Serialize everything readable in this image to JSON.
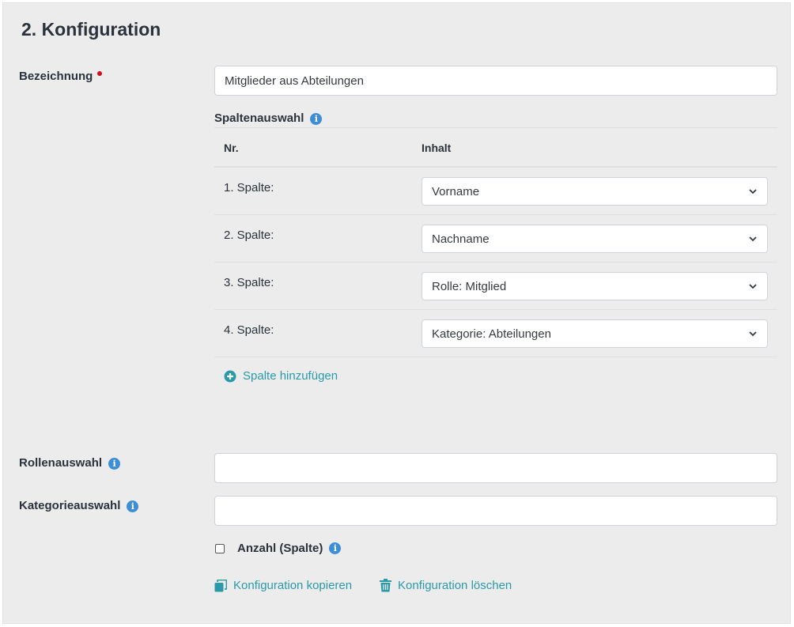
{
  "section_title": "2. Konfiguration",
  "bezeichnung": {
    "label": "Bezeichnung",
    "value": "Mitglieder aus Abteilungen"
  },
  "spaltenauswahl": {
    "label": "Spaltenauswahl",
    "col_nr": "Nr.",
    "col_inhalt": "Inhalt",
    "rows": [
      {
        "nr": "1. Spalte:",
        "value": "Vorname"
      },
      {
        "nr": "2. Spalte:",
        "value": "Nachname"
      },
      {
        "nr": "3. Spalte:",
        "value": "Rolle: Mitglied"
      },
      {
        "nr": "4. Spalte:",
        "value": "Kategorie: Abteilungen"
      }
    ],
    "add_label": "Spalte hinzufügen"
  },
  "rollenauswahl": {
    "label": "Rollenauswahl",
    "value": ""
  },
  "kategorieauswahl": {
    "label": "Kategorieauswahl",
    "value": ""
  },
  "anzahl": {
    "label": "Anzahl (Spalte)",
    "checked": false
  },
  "actions": {
    "copy_label": "Konfiguration kopieren",
    "delete_label": "Konfiguration löschen"
  },
  "colors": {
    "accent": "#2a9aa8",
    "info": "#3d8ed6",
    "required": "#d10f1f"
  }
}
